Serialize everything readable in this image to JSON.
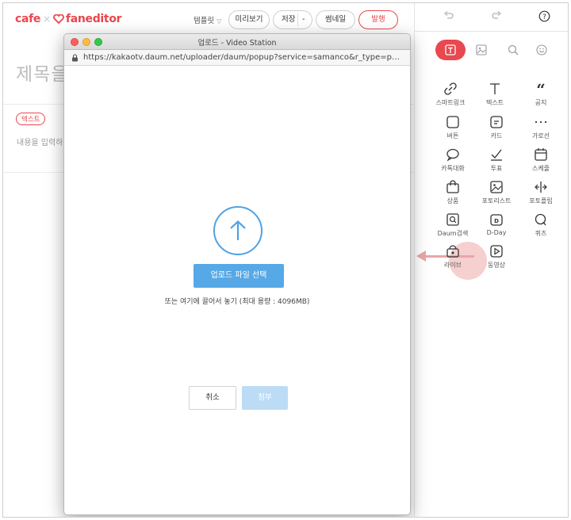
{
  "header": {
    "logo_cafe": "cafe",
    "logo_sep": "×",
    "logo_fan": "faneditor",
    "template": "템플릿",
    "preview": "미리보기",
    "save": "저장",
    "save_more": "-",
    "thumbnail": "썸네일",
    "publish": "발행"
  },
  "editor": {
    "title_placeholder": "제목을",
    "tag": "텍스트",
    "content_placeholder": "내용을 입력하"
  },
  "popup": {
    "window_title": "업로드 - Video Station",
    "url": "https://kakaotv.daum.net/uploader/daum/popup?service=samanco&r_type=popup...",
    "select_button": "업로드 파일 선택",
    "drop_note": "또는 여기에 끌어서 놓기 (최대 용량 : 4096MB)",
    "cancel": "취소",
    "attach": "첨부"
  },
  "panel": {
    "items": [
      {
        "label": "스마트링크",
        "icon": "link-icon"
      },
      {
        "label": "텍스트",
        "icon": "text-icon"
      },
      {
        "label": "공지",
        "icon": "quote-icon"
      },
      {
        "label": "버튼",
        "icon": "button-icon"
      },
      {
        "label": "카드",
        "icon": "card-icon"
      },
      {
        "label": "가로선",
        "icon": "divider-icon"
      },
      {
        "label": "카톡대화",
        "icon": "chat-icon"
      },
      {
        "label": "투표",
        "icon": "vote-icon"
      },
      {
        "label": "스케줄",
        "icon": "calendar-icon"
      },
      {
        "label": "상품",
        "icon": "bag-icon"
      },
      {
        "label": "포토리스트",
        "icon": "photo-list-icon"
      },
      {
        "label": "포토플립",
        "icon": "photo-flip-icon"
      },
      {
        "label": "Daum검색",
        "icon": "daum-search-icon"
      },
      {
        "label": "D-Day",
        "icon": "dday-icon"
      },
      {
        "label": "퀴즈",
        "icon": "quiz-icon"
      },
      {
        "label": "라이브",
        "icon": "live-icon"
      },
      {
        "label": "동영상",
        "icon": "video-icon"
      }
    ]
  },
  "colors": {
    "accent": "#e8484f",
    "upload_blue": "#56a8e6",
    "highlight": "#f6cfcf"
  }
}
